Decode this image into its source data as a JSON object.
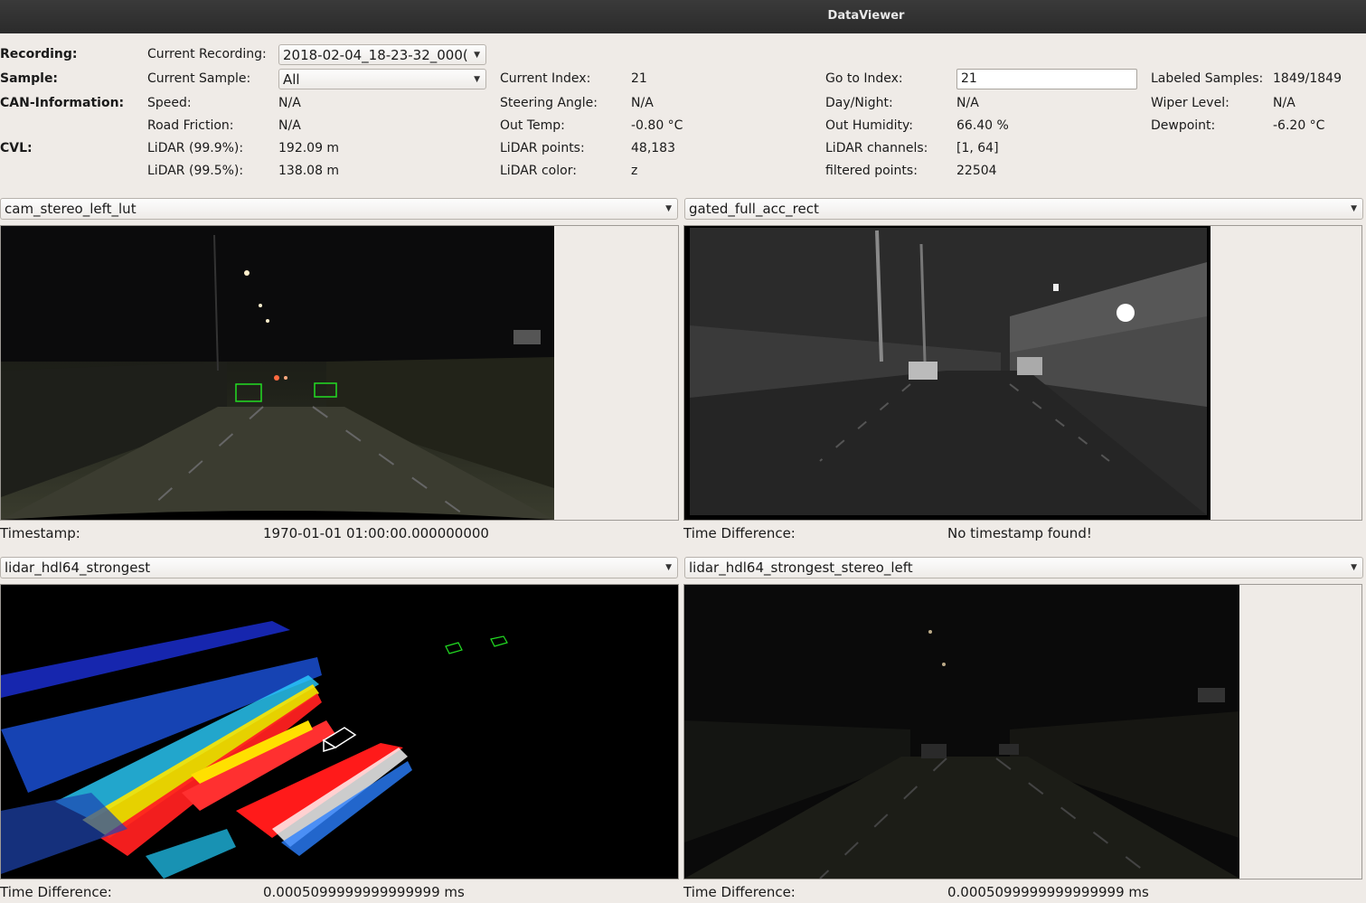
{
  "window": {
    "title": "DataViewer"
  },
  "info": {
    "recording_label": "Recording:",
    "sample_label": "Sample:",
    "can_label": "CAN-Information:",
    "cvl_label": "CVL:",
    "current_recording_label": "Current Recording:",
    "current_recording_value": "2018-02-04_18-23-32_000(",
    "current_sample_label": "Current Sample:",
    "current_sample_value": "All",
    "current_index_label": "Current Index:",
    "current_index_value": "21",
    "goto_index_label": "Go to Index:",
    "goto_index_value": "21",
    "labeled_samples_label": "Labeled Samples:",
    "labeled_samples_value": "1849/1849",
    "speed_label": "Speed:",
    "speed_value": "N/A",
    "steering_label": "Steering Angle:",
    "steering_value": "N/A",
    "daynight_label": "Day/Night:",
    "daynight_value": "N/A",
    "wiper_label": "Wiper Level:",
    "wiper_value": "N/A",
    "friction_label": "Road Friction:",
    "friction_value": "N/A",
    "outtemp_label": "Out Temp:",
    "outtemp_value": "-0.80 °C",
    "humidity_label": "Out Humidity:",
    "humidity_value": "66.40 %",
    "dewpoint_label": "Dewpoint:",
    "dewpoint_value": "-6.20 °C",
    "lidar999_label": "LiDAR (99.9%):",
    "lidar999_value": "192.09 m",
    "lidarpoints_label": "LiDAR points:",
    "lidarpoints_value": "48,183",
    "lidarchannels_label": "LiDAR channels:",
    "lidarchannels_value": "[1, 64]",
    "lidar995_label": "LiDAR (99.5%):",
    "lidar995_value": "138.08 m",
    "lidarcolor_label": "LiDAR color:",
    "lidarcolor_value": "z",
    "filtered_label": "filtered points:",
    "filtered_value": "22504"
  },
  "views": {
    "top_left": {
      "selector": "cam_stereo_left_lut",
      "footer_label": "Timestamp:",
      "footer_value": "1970-01-01 01:00:00.000000000"
    },
    "top_right": {
      "selector": "gated_full_acc_rect",
      "footer_label": "Time Difference:",
      "footer_value": "No timestamp found!"
    },
    "bottom_left": {
      "selector": "lidar_hdl64_strongest",
      "footer_label": "Time Difference:",
      "footer_value": "0.0005099999999999999 ms"
    },
    "bottom_right": {
      "selector": "lidar_hdl64_strongest_stereo_left",
      "footer_label": "Time Difference:",
      "footer_value": "0.0005099999999999999 ms"
    }
  },
  "colors": {
    "titlebar": "#2f2f2f",
    "panel": "#efebe7",
    "bbox": "#22dd22"
  }
}
